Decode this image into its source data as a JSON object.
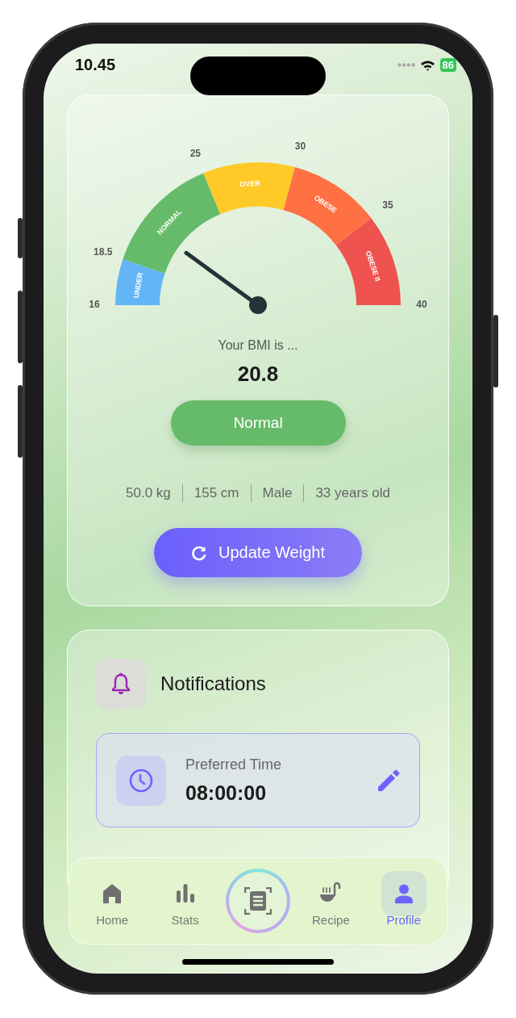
{
  "status_bar": {
    "time": "10.45",
    "battery": "86"
  },
  "gauge": {
    "ticks": [
      "16",
      "18.5",
      "25",
      "30",
      "35",
      "40"
    ],
    "segments": [
      {
        "label": "UNDER",
        "color": "#64b5f6"
      },
      {
        "label": "NORMAL",
        "color": "#66bb6a"
      },
      {
        "label": "OVER",
        "color": "#ffca28"
      },
      {
        "label": "OBESE",
        "color": "#ff7043"
      },
      {
        "label": "OBESE II",
        "color": "#ef5350"
      }
    ]
  },
  "bmi": {
    "caption": "Your BMI is ...",
    "value": "20.8",
    "category": "Normal"
  },
  "stats": [
    "50.0 kg",
    "155 cm",
    "Male",
    "33 years old"
  ],
  "update_button": "Update Weight",
  "notifications": {
    "title": "Notifications",
    "preferred_time": {
      "label": "Preferred Time",
      "value": "08:00:00"
    }
  },
  "nav": [
    {
      "kind": "home",
      "label": "Home",
      "selected": false
    },
    {
      "kind": "stats",
      "label": "Stats",
      "selected": false
    },
    {
      "kind": "scan",
      "selected": false
    },
    {
      "kind": "recipe",
      "label": "Recipe",
      "selected": false
    },
    {
      "kind": "profile",
      "label": "Profile",
      "selected": true
    }
  ]
}
